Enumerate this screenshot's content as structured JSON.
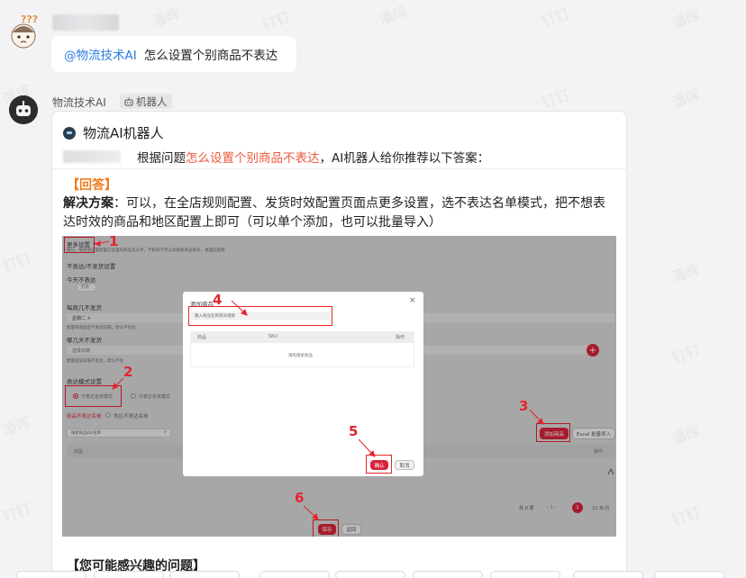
{
  "watermark_text": "潘晖",
  "watermark_text_2": "钉钉",
  "user_message": {
    "mention": "@物流技术AI",
    "text": "怎么设置个别商品不表达"
  },
  "bot": {
    "name": "物流技术AI",
    "tag_label": "机器人"
  },
  "card": {
    "title": "物流AI机器人",
    "sub_prefix": "根据问题",
    "sub_highlight": "怎么设置个别商品不表达",
    "sub_suffix": "，AI机器人给你推荐以下答案：",
    "answer_tag": "【回答】",
    "solution_label": "解决方案",
    "solution_text": "：可以，在全店规则配置、发货时效配置页面点更多设置，选不表达名单模式，把不想表达时效的商品和地区配置上即可（可以单个添加，也可以批量导入）",
    "interest_title": "【您可能感兴趣的问题】"
  },
  "screenshot": {
    "more_settings": "更多设置 ^",
    "top_note": "确认，被依照设置配置已设置的商品及分享，不影响下单以及相关商品状态，将面向后端",
    "section_title": "不表达/不发货设置",
    "today_label": "今天不表达",
    "today_note": "打开",
    "every_label": "每周几不发货",
    "select_value": "星期二 ×",
    "every_note": "配置每周固定不发货日期，默认不包含",
    "days_label": "哪几天不发货",
    "date_placeholder": "选择日期",
    "date_note": "配置后该日期不发货，默认不含",
    "mode_label": "表达模式设置",
    "radio_1": "不表达名单模式",
    "radio_2": "只表达名单模式",
    "link_1": "商品不表达名单",
    "link_2": "地区不表达名单",
    "search_placeholder": "搜索商品ID/名称",
    "col_goods": "商品",
    "col_op": "操作",
    "add_goods_btn": "添加商品",
    "excel_btn": "Excel 批量导入",
    "pagination_total": "共 0 项",
    "page_current": "1",
    "page_size": "10 条/页",
    "save_btn": "保存",
    "back_btn": "返回",
    "dialog": {
      "title": "添加商品",
      "close": "×",
      "search_placeholder": "输入商品名称或ID搜索",
      "col_goods": "商品",
      "col_sku": "SKU",
      "col_op": "操作",
      "empty": "请先搜索商品",
      "ok_btn": "确认",
      "cancel_btn": "取消"
    },
    "step_labels": [
      "1",
      "2",
      "3",
      "4",
      "5",
      "6"
    ]
  }
}
